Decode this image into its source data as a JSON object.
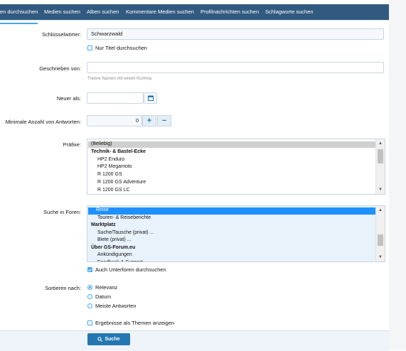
{
  "tabs": [
    "en durchsuchen",
    "Medien suchen",
    "Alben suchen",
    "Kommentare Medien suchen",
    "Profilnachrichten suchen",
    "Schlagworte suchen"
  ],
  "form": {
    "keywords_label": "Schlüsselwörter:",
    "keywords_value": "Schwarzwald",
    "title_only_label": "Nur Titel durchsuchen",
    "author_label": "Geschrieben von:",
    "author_value": "",
    "author_hint": "Trenne Namen mit einem Komma.",
    "newer_label": "Neuer als:",
    "newer_value": "",
    "min_replies_label": "Minimale Anzahl von Antworten:",
    "min_replies_value": "0",
    "prefixes_label": "Präfixe:",
    "prefixes": [
      {
        "label": "(Beliebig)",
        "type": "selected"
      },
      {
        "label": "Technik- & Bastel-Ecke",
        "type": "group"
      },
      {
        "label": "HP2 Enduro",
        "type": "item"
      },
      {
        "label": "HP2 Megamoto",
        "type": "item"
      },
      {
        "label": "R 1200 GS",
        "type": "item"
      },
      {
        "label": "R 1200 GS Adventure",
        "type": "item"
      },
      {
        "label": "R 1200 GS LC",
        "type": "item"
      }
    ],
    "forums_label": "Suche in Foren:",
    "forums": [
      {
        "label": "Reise",
        "type": "highlight"
      },
      {
        "label": "Touren- & Reiseberichte",
        "type": "item"
      },
      {
        "label": "Marktplatz",
        "type": "group"
      },
      {
        "label": "Suche/Tausche (privat) ...",
        "type": "item"
      },
      {
        "label": "Biete (privat) ...",
        "type": "item"
      },
      {
        "label": "Über GS-Forum.eu",
        "type": "group"
      },
      {
        "label": "Ankündigungen",
        "type": "item"
      },
      {
        "label": "Feedback & Support",
        "type": "item"
      }
    ],
    "subforums_label": "Auch Unterforen durchsuchen",
    "sort_label": "Sortieren nach:",
    "sort_options": [
      "Relevanz",
      "Datum",
      "Meiste Antworten"
    ],
    "sort_selected": "Relevanz",
    "as_threads_label": "Ergebnisse als Themen anzeigen",
    "search_button": "Suche"
  },
  "colors": {
    "header": "#315a80",
    "accent": "#47a7eb",
    "button": "#2577b1",
    "selection": "#1e90ff"
  }
}
